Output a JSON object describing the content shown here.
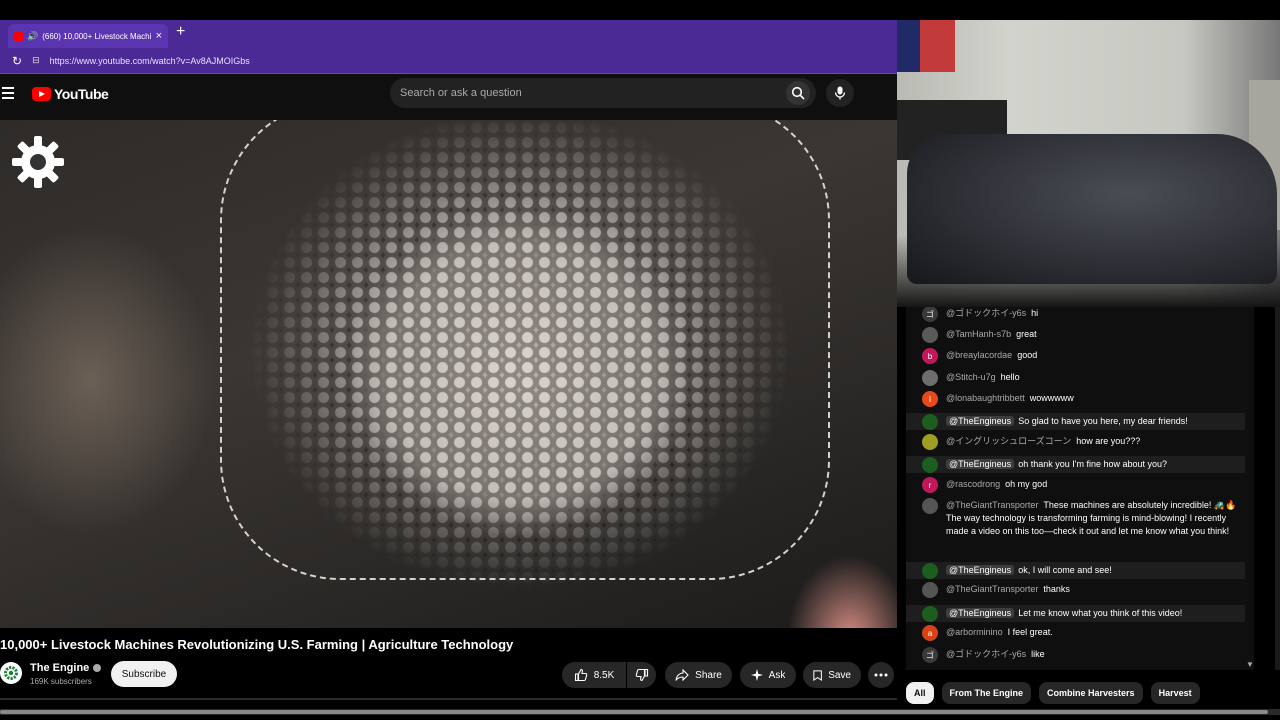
{
  "browser": {
    "tab_title": "(660) 10,000+ Livestock Machi",
    "close": "×",
    "new_tab": "+",
    "url": "https://www.youtube.com/watch?v=Av8AJMOIGbs"
  },
  "header": {
    "logo_text": "YouTube",
    "search_placeholder": "Search or ask a question"
  },
  "video": {
    "title": "10,000+ Livestock Machines Revolutionizing U.S. Farming | Agriculture Technology",
    "channel": "The Engine",
    "subscribers": "169K subscribers",
    "subscribe_label": "Subscribe",
    "like_count": "8.5K",
    "share_label": "Share",
    "ask_label": "Ask",
    "save_label": "Save"
  },
  "chat": {
    "messages": [
      {
        "author": "@ゴドックホイ-y6s",
        "text": "hi",
        "avatar_color": "#3a3a3a",
        "initial": "ゴ",
        "owner": false
      },
      {
        "author": "@TamHanh-s7b",
        "text": "great",
        "avatar_color": "#5a5a5a",
        "initial": "",
        "owner": false
      },
      {
        "author": "@breaylacordae",
        "text": "good",
        "avatar_color": "#c2185b",
        "initial": "b",
        "owner": false
      },
      {
        "author": "@Stitch-u7g",
        "text": "hello",
        "avatar_color": "#6d6d6d",
        "initial": "",
        "owner": false
      },
      {
        "author": "@lonabaughtribbett",
        "text": "wowwwww",
        "avatar_color": "#e64a19",
        "initial": "l",
        "owner": false
      },
      {
        "author": "@TheEngineus",
        "text": "So glad to have you here, my dear friends!",
        "avatar_color": "#1b5e20",
        "initial": "",
        "owner": true
      },
      {
        "author": "@イングリッシュローズコーン",
        "text": "how are you???",
        "avatar_color": "#9e9d24",
        "initial": "",
        "owner": false
      },
      {
        "author": "@TheEngineus",
        "text": "oh thank you I'm fine how about you?",
        "avatar_color": "#1b5e20",
        "initial": "",
        "owner": true
      },
      {
        "author": "@rascodrong",
        "text": "oh my god",
        "avatar_color": "#c2185b",
        "initial": "r",
        "owner": false
      },
      {
        "author": "@TheGiantTransporter",
        "text": "These machines are absolutely incredible! 🚜🔥 The way technology is transforming farming is mind-blowing! I recently made a video on this too—check it out and let me know what you think!",
        "avatar_color": "#555555",
        "initial": "",
        "owner": false
      },
      {
        "author": "@TheEngineus",
        "text": "ok, I will come and see!",
        "avatar_color": "#1b5e20",
        "initial": "",
        "owner": true
      },
      {
        "author": "@TheGiantTransporter",
        "text": "thanks",
        "avatar_color": "#555555",
        "initial": "",
        "owner": false
      },
      {
        "author": "@TheEngineus",
        "text": "Let me know what you think of this video!",
        "avatar_color": "#1b5e20",
        "initial": "",
        "owner": true
      },
      {
        "author": "@arborminino",
        "text": "I feel great.",
        "avatar_color": "#d84315",
        "initial": "a",
        "owner": false
      },
      {
        "author": "@ゴドックホイ-y6s",
        "text": "like",
        "avatar_color": "#3a3a3a",
        "initial": "ゴ",
        "owner": false
      }
    ]
  },
  "chips": [
    "All",
    "From The Engine",
    "Combine Harvesters",
    "Harvest"
  ],
  "icons": {
    "reload": "reload-icon",
    "lock": "site-info-icon",
    "search": "search-icon",
    "mic": "mic-icon",
    "like": "thumbs-up-icon",
    "dislike": "thumbs-down-icon",
    "share": "share-icon",
    "ask": "sparkle-icon",
    "save": "bookmark-icon",
    "more": "more-icon"
  },
  "colors": {
    "browser_accent": "#4c2a96",
    "youtube_red": "#ff0000",
    "background": "#0f0f0f"
  }
}
